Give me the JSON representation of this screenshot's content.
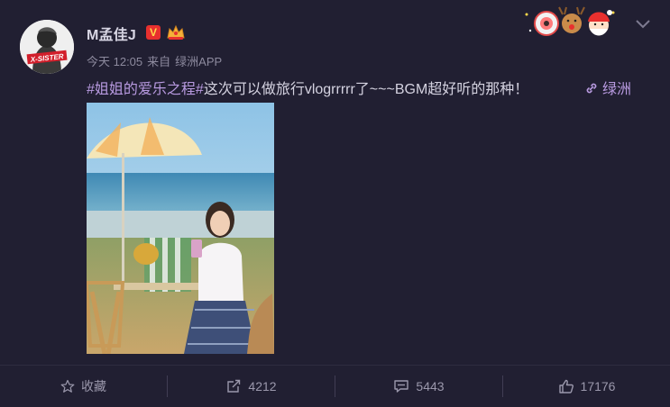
{
  "user": {
    "name": "M孟佳J",
    "vip_badge": "V",
    "avatar_text": "X-SISTER"
  },
  "meta": {
    "time": "今天 12:05",
    "source_prefix": "来自",
    "source": "绿洲APP"
  },
  "post": {
    "hashtag": "#姐姐的爱乐之程#",
    "text": "这次可以做旅行vlogrrrrr了~~~BGM超好听的那种！",
    "link_label": "绿洲"
  },
  "actions": {
    "favorite_label": "收藏",
    "repost_count": "4212",
    "comment_count": "5443",
    "like_count": "17176"
  },
  "colors": {
    "background": "#211f32",
    "accent": "#b89ae0",
    "muted": "#9b98ac"
  }
}
